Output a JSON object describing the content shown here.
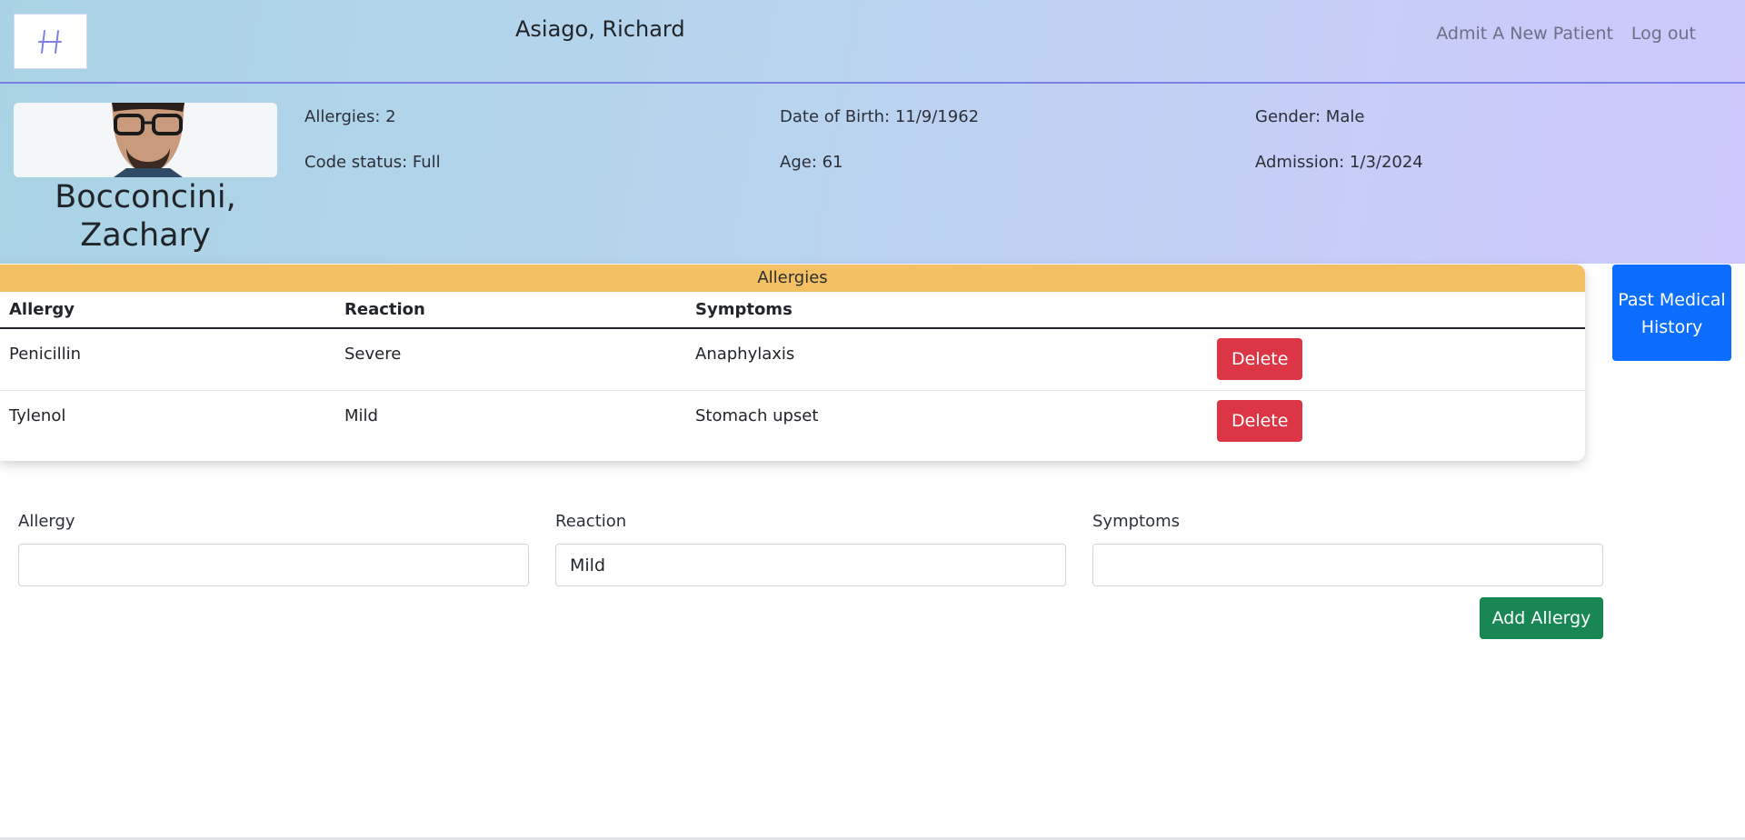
{
  "navbar": {
    "logo_text": "H",
    "user_name": "Asiago, Richard",
    "links": [
      "Admit A New Patient",
      "Log out"
    ]
  },
  "patient": {
    "name": "Bocconcini, Zachary",
    "allergies_count": "Allergies: 2",
    "code_status": "Code status: Full",
    "dob": "Date of Birth: 11/9/1962",
    "age": "Age: 61",
    "gender": "Gender: Male",
    "admission": "Admission: 1/3/2024"
  },
  "allergy_table": {
    "title": "Allergies",
    "headers": [
      "Allergy",
      "Reaction",
      "Symptoms"
    ],
    "rows": [
      {
        "allergy": "Penicillin",
        "reaction": "Severe",
        "symptoms": "Anaphylaxis",
        "action": "Delete"
      },
      {
        "allergy": "Tylenol",
        "reaction": "Mild",
        "symptoms": "Stomach upset",
        "action": "Delete"
      }
    ]
  },
  "past_medical_history_button": "Past Medical History",
  "form": {
    "allergy_label": "Allergy",
    "allergy_value": "",
    "reaction_label": "Reaction",
    "reaction_value": "Mild",
    "symptoms_label": "Symptoms",
    "symptoms_value": "",
    "submit_label": "Add Allergy"
  },
  "colors": {
    "header_gradient_start": "#a9d3e4",
    "header_gradient_end": "#ccc8fd",
    "card_header": "#f3c164",
    "danger": "#dc3545",
    "primary": "#0d6efd",
    "success": "#198754"
  }
}
